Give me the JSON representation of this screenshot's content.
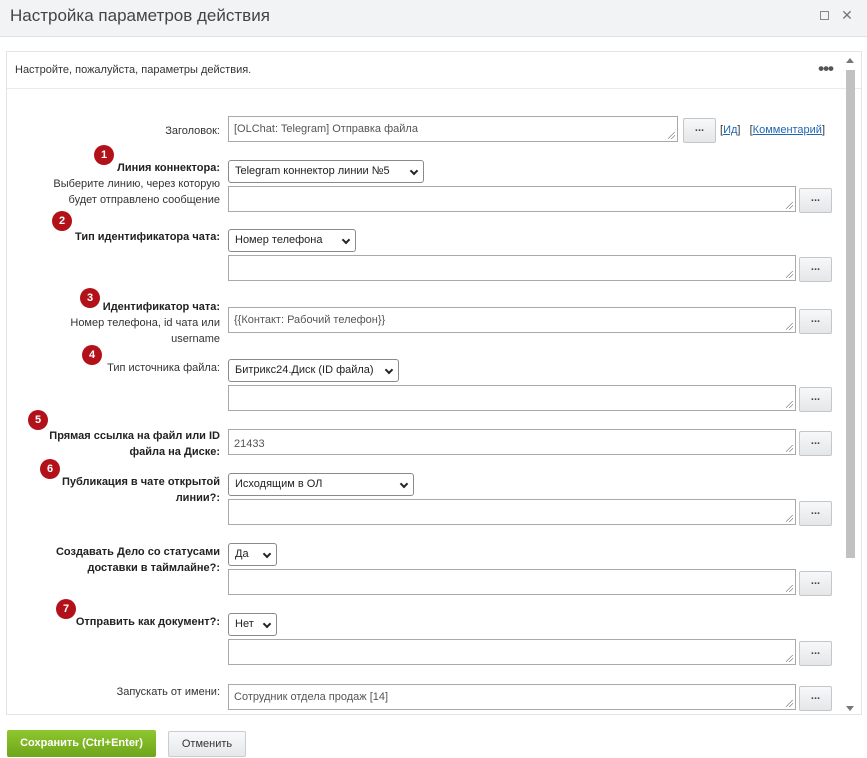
{
  "window": {
    "title": "Настройка параметров действия"
  },
  "dialog": {
    "caption": "Настройте, пожалуйста, параметры действия.",
    "more_icon": "more-dots-icon"
  },
  "fields": {
    "title": {
      "label": "Заголовок:",
      "value": "[OLChat: Telegram] Отправка файла",
      "link_id": "Ид",
      "link_comment": "Комментарий"
    },
    "connector_line": {
      "label": "Линия коннектора:",
      "hint_line1": "Выберите линию, через которую",
      "hint_line2": "будет отправлено сообщение",
      "select": "Telegram коннектор линии №5"
    },
    "chat_id_type": {
      "label": "Тип идентификатора чата:",
      "select": "Номер телефона"
    },
    "chat_id": {
      "label": "Идентификатор чата:",
      "hint_line1": "Номер телефона, id чата или",
      "hint_line2": "username",
      "value": "{{Контакт: Рабочий телефон}}"
    },
    "file_source_type": {
      "label": "Тип источника файла:",
      "select": "Битрикс24.Диск (ID файла)"
    },
    "file_link": {
      "label_line1": "Прямая ссылка на файл или ID",
      "label_line2": "файла на Диске:",
      "value": "21433"
    },
    "publish_in_chat": {
      "label_line1": "Публикация в чате открытой",
      "label_line2": "линии?:",
      "select": "Исходящим в ОЛ"
    },
    "create_task": {
      "label_line1": "Создавать Дело со статусами",
      "label_line2": "доставки в таймлайне?:",
      "select": "Да"
    },
    "send_as_document": {
      "label": "Отправить как документ?:",
      "select": "Нет"
    },
    "run_as": {
      "label": "Запускать от имени:",
      "value": "Сотрудник отдела продаж [14]"
    }
  },
  "badges": [
    "1",
    "2",
    "3",
    "4",
    "5",
    "6",
    "7"
  ],
  "dots_label": "...",
  "footer": {
    "save_label": "Сохранить (Ctrl+Enter)",
    "cancel_label": "Отменить"
  },
  "colors": {
    "badge": "#b3111a",
    "save_button": "#7cb526",
    "link": "#2067b0"
  }
}
